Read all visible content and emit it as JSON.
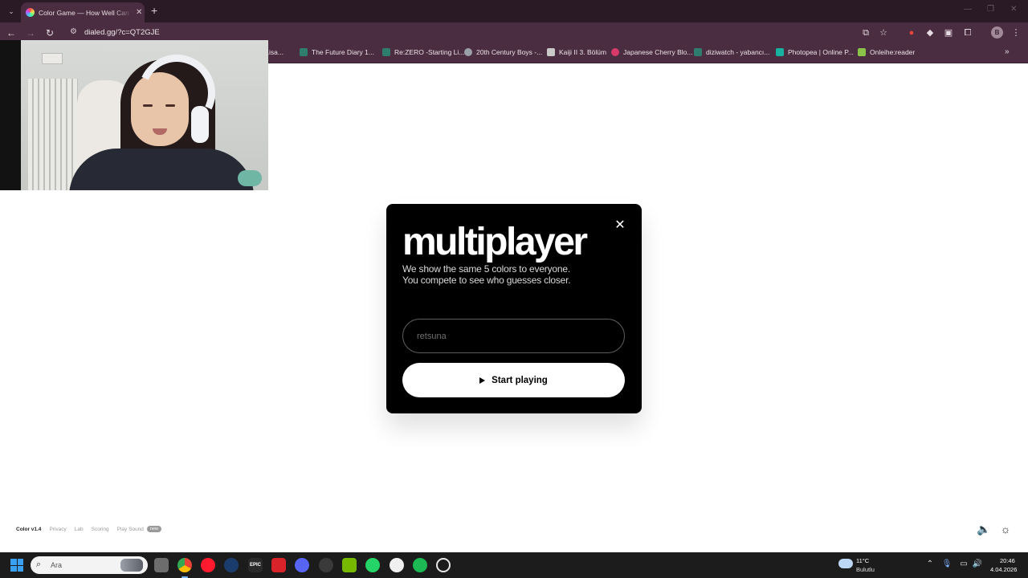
{
  "browser": {
    "tab_title": "Color Game — How Well Can You See Color?",
    "url": "dialed.gg/?c=QT2GJE",
    "profile_initial": "B",
    "bookmarks": [
      {
        "label": "i Lisa...",
        "color": "#8a6a9a"
      },
      {
        "label": "The Future Diary 1...",
        "color": "#2f7d6e"
      },
      {
        "label": "Re:ZERO -Starting Li...",
        "color": "#2f7d6e"
      },
      {
        "label": "20th Century Boys -...",
        "color": "#9aa0a8"
      },
      {
        "label": "Kaiji II 3. Bölüm",
        "color": "#c9c9c9"
      },
      {
        "label": "Japanese Cherry Blo...",
        "color": "#d83a6a"
      },
      {
        "label": "diziwatch - yabancı...",
        "color": "#2f7d6e"
      },
      {
        "label": "Photopea | Online P...",
        "color": "#17b3a0"
      },
      {
        "label": "Onleihe:reader",
        "color": "#8bc34a"
      }
    ]
  },
  "modal": {
    "title": "multiplayer",
    "description_line1": "We show the same 5 colors to everyone.",
    "description_line2": "You compete to see who guesses closer.",
    "name_placeholder": "retsuna",
    "start_label": "Start playing"
  },
  "footer": {
    "version": "Color v1.4",
    "privacy": "Privacy",
    "lab": "Lab",
    "scoring": "Scoring",
    "play_sound": "Play Sound",
    "badge": "new"
  },
  "taskbar": {
    "search_placeholder": "Ara",
    "weather_temp": "11°C",
    "weather_condition": "Bulutlu",
    "time": "20:46",
    "date": "4.04.2026"
  },
  "colors": {
    "tabbar_bg": "#2a1a26",
    "toolbar_bg": "#4a2d40",
    "modal_bg": "#000000",
    "button_bg": "#ffffff"
  }
}
